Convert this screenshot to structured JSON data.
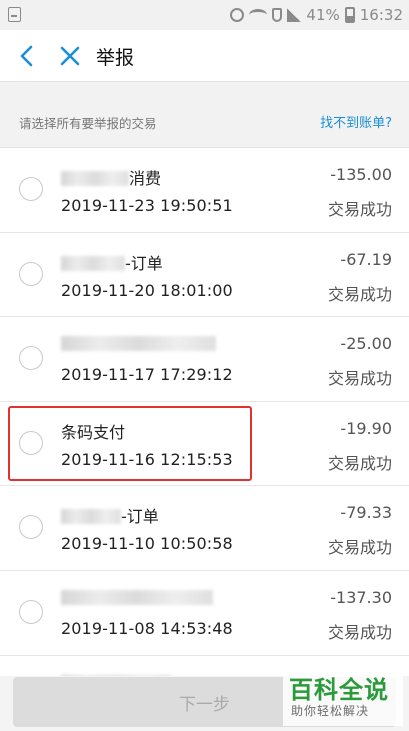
{
  "status_bar": {
    "battery": "41%",
    "time": "16:32"
  },
  "nav": {
    "title": "举报",
    "back_icon": "chevron-left-icon",
    "close_icon": "close-icon",
    "accent": "#1a8fd6"
  },
  "prompt": {
    "text": "请选择所有要举报的交易",
    "link": "找不到账单?"
  },
  "transactions": [
    {
      "title": "消费",
      "redacted": true,
      "date": "2019-11-23 19:50:51",
      "amount": "-135.00",
      "status": "交易成功"
    },
    {
      "title": "-订单",
      "redacted": true,
      "date": "2019-11-20 18:01:00",
      "amount": "-67.19",
      "status": "交易成功"
    },
    {
      "title": "",
      "redacted": true,
      "date": "2019-11-17 17:29:12",
      "amount": "-25.00",
      "status": "交易成功"
    },
    {
      "title": "条码支付",
      "redacted": false,
      "date": "2019-11-16 12:15:53",
      "amount": "-19.90",
      "status": "交易成功"
    },
    {
      "title": "-订单",
      "redacted": true,
      "date": "2019-11-10 10:50:58",
      "amount": "-79.33",
      "status": "交易成功"
    },
    {
      "title": "",
      "redacted": true,
      "date": "2019-11-08 14:53:48",
      "amount": "-137.30",
      "status": "交易成功"
    }
  ],
  "highlight_color": "#e0322f",
  "footer": {
    "next_label": "下一步"
  },
  "watermark": {
    "main": "百科全说",
    "sub": "助你轻松解决"
  }
}
